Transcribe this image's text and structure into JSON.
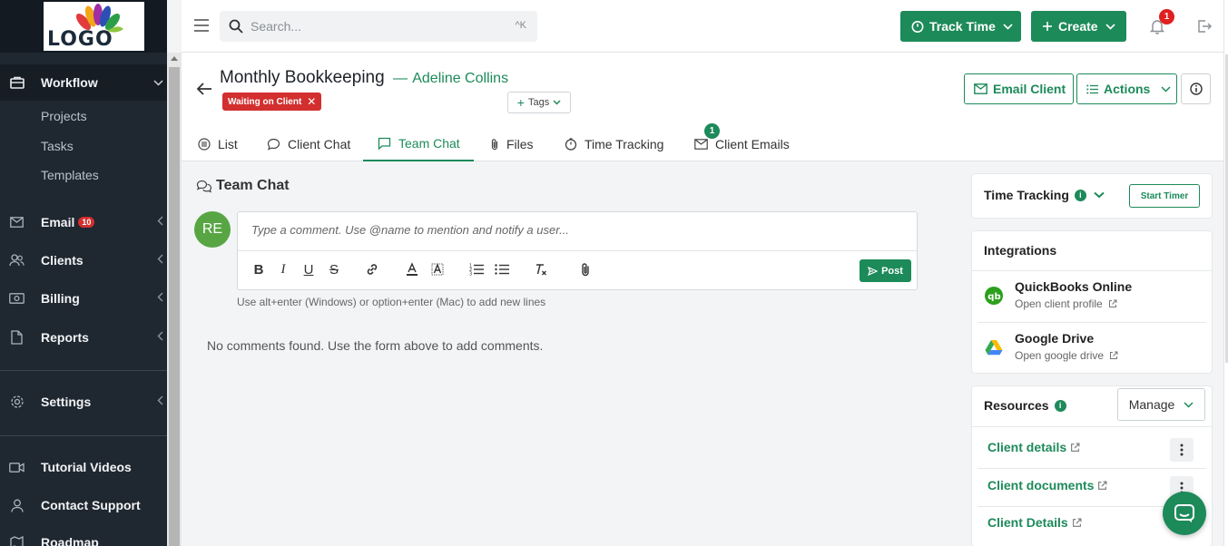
{
  "brand": {
    "logo_text": "LOGO"
  },
  "sidebar": {
    "workflow": {
      "label": "Workflow",
      "sub": [
        "Projects",
        "Tasks",
        "Templates"
      ]
    },
    "email": {
      "label": "Email",
      "badge": "10"
    },
    "clients": {
      "label": "Clients"
    },
    "billing": {
      "label": "Billing"
    },
    "reports": {
      "label": "Reports"
    },
    "settings": {
      "label": "Settings"
    },
    "tutorial": {
      "label": "Tutorial Videos"
    },
    "support": {
      "label": "Contact Support"
    },
    "roadmap": {
      "label": "Roadmap"
    }
  },
  "topbar": {
    "search_placeholder": "Search...",
    "search_shortcut": "^K",
    "track_time": "Track Time",
    "create": "Create",
    "notifications_count": "1"
  },
  "header": {
    "title": "Monthly Bookkeeping",
    "separator": "—",
    "client": "Adeline Collins",
    "status": "Waiting on Client",
    "tags": "Tags",
    "email_client": "Email Client",
    "actions": "Actions"
  },
  "tabs": [
    {
      "label": "List"
    },
    {
      "label": "Client Chat"
    },
    {
      "label": "Team Chat"
    },
    {
      "label": "Files"
    },
    {
      "label": "Time Tracking"
    },
    {
      "label": "Client Emails",
      "badge": "1"
    }
  ],
  "chat": {
    "title": "Team Chat",
    "avatar_initials": "RE",
    "placeholder": "Type a comment. Use @name to mention and notify a user...",
    "post": "Post",
    "hint": "Use alt+enter (Windows) or option+enter (Mac) to add new lines",
    "empty": "No comments found. Use the form above to add comments."
  },
  "panels": {
    "time_tracking": {
      "title": "Time Tracking",
      "start": "Start Timer",
      "info": "i"
    },
    "integrations": {
      "title": "Integrations",
      "items": [
        {
          "name": "QuickBooks Online",
          "sub": "Open client profile"
        },
        {
          "name": "Google Drive",
          "sub": "Open google drive"
        }
      ]
    },
    "resources": {
      "title": "Resources",
      "info": "i",
      "manage": "Manage",
      "links": [
        "Client details",
        "Client documents",
        "Client Details"
      ]
    }
  },
  "colors": {
    "accent": "#1d8a5a",
    "danger": "#d32f2f",
    "sidebar": "#1f2730"
  }
}
